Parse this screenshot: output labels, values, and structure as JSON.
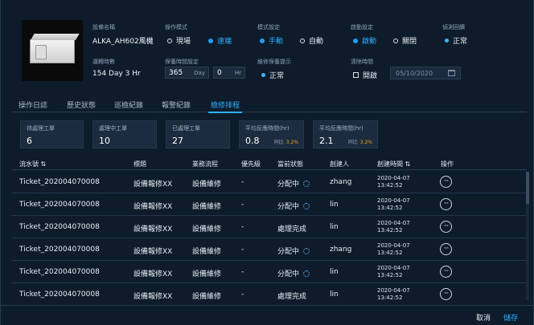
{
  "device": {
    "name_label": "設備名稱",
    "name_value": "ALKA_AH602風機",
    "mode_label": "操作模式",
    "mode_options": [
      "現場",
      "遠端"
    ],
    "setting_label": "模式設定",
    "setting_options": [
      "手動",
      "自動"
    ],
    "start_label": "啟動設定",
    "start_options": [
      "啟動",
      "關閉"
    ],
    "fault_label": "偵測回饋",
    "fault_value": "正常",
    "runtime_label": "運轉時數",
    "runtime_value": "154 Day  3 Hr",
    "maint_label": "保養時間設定",
    "maint_days": "365",
    "maint_day_unit": "Day",
    "maint_hours": "0",
    "maint_hr_unit": "Hr",
    "notice_label": "維修保養提示",
    "notice_value": "正常",
    "clear_label": "清除時間",
    "clear_checkbox": "開啟",
    "clear_date": "05/10/2020"
  },
  "tabs": [
    "操作日誌",
    "歷史狀態",
    "巡檢紀錄",
    "報警紀錄",
    "檢修排程"
  ],
  "stats": [
    {
      "title": "待處理工單",
      "value": "6"
    },
    {
      "title": "處理中工單",
      "value": "10"
    },
    {
      "title": "已處理工單",
      "value": "27"
    },
    {
      "title": "平均反應時間(hr)",
      "value": "0.8",
      "compare_label": "同比",
      "compare_value": "3.2%"
    },
    {
      "title": "平均反應時間(hr)",
      "value": "2.1",
      "compare_label": "同比",
      "compare_value": "3.2%"
    }
  ],
  "table": {
    "headers": [
      "流水號",
      "標題",
      "業務流程",
      "優先級",
      "當前狀態",
      "創建人",
      "創建時間",
      "操作"
    ],
    "rows": [
      {
        "id": "Ticket_202004070008",
        "title": "設備報修XX",
        "flow": "設備維修",
        "priority": "-",
        "status": "分配中",
        "creator": "zhang",
        "date": "2020-04-07",
        "time": "13:42:52"
      },
      {
        "id": "Ticket_202004070008",
        "title": "設備報修XX",
        "flow": "設備維修",
        "priority": "-",
        "status": "分配中",
        "creator": "lin",
        "date": "2020-04-07",
        "time": "13:42:52"
      },
      {
        "id": "Ticket_202004070008",
        "title": "設備報修XX",
        "flow": "設備維修",
        "priority": "-",
        "status": "處理完成",
        "creator": "lin",
        "date": "2020-04-07",
        "time": "13:42:52"
      },
      {
        "id": "Ticket_202004070008",
        "title": "設備報修XX",
        "flow": "設備維修",
        "priority": "-",
        "status": "分配中",
        "creator": "zhang",
        "date": "2020-04-07",
        "time": "13:42:52"
      },
      {
        "id": "Ticket_202004070008",
        "title": "設備報修XX",
        "flow": "設備維修",
        "priority": "-",
        "status": "分配中",
        "creator": "lin",
        "date": "2020-04-07",
        "time": "13:42:52"
      },
      {
        "id": "Ticket_202004070008",
        "title": "設備報修XX",
        "flow": "設備維修",
        "priority": "-",
        "status": "處理完成",
        "creator": "lin",
        "date": "2020-04-07",
        "time": "13:42:52"
      }
    ]
  },
  "footer": {
    "cancel": "取消",
    "save": "儲存"
  },
  "colors": {
    "accent": "#2fb0ff",
    "background": "#0d1b2b",
    "card": "#1c2b3d",
    "compare": "#f0a81e"
  }
}
